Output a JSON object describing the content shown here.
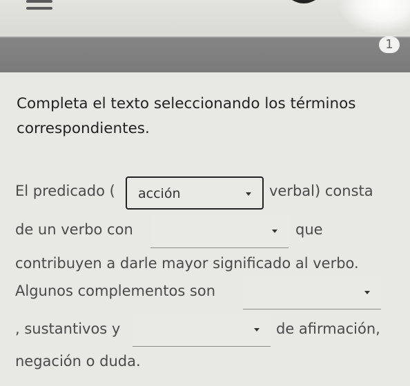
{
  "header": {
    "question_number": "1"
  },
  "instruction": "Completa el texto seleccionando los términos correspondientes.",
  "text": {
    "line1_pre": "El predicado (",
    "line1_post": "verbal) consta",
    "line2_pre": "de un verbo con",
    "line2_post": "que",
    "line3": "contribuyen a darle mayor significado al verbo.",
    "line4_pre": "Algunos complementos son",
    "line5_pre": ", sustantivos y",
    "line5_post": "de afirmación,",
    "line6": "negación o duda."
  },
  "selects": {
    "s1": {
      "value": "acción"
    },
    "s2": {
      "value": ""
    },
    "s3": {
      "value": ""
    },
    "s4": {
      "value": ""
    }
  },
  "colors": {
    "progress": "#7f7f7f",
    "background": "#e8e8e5",
    "text": "#4a4a4a"
  },
  "icons": [
    "menu-icon",
    "gear-icon",
    "chevron-down-icon"
  ]
}
